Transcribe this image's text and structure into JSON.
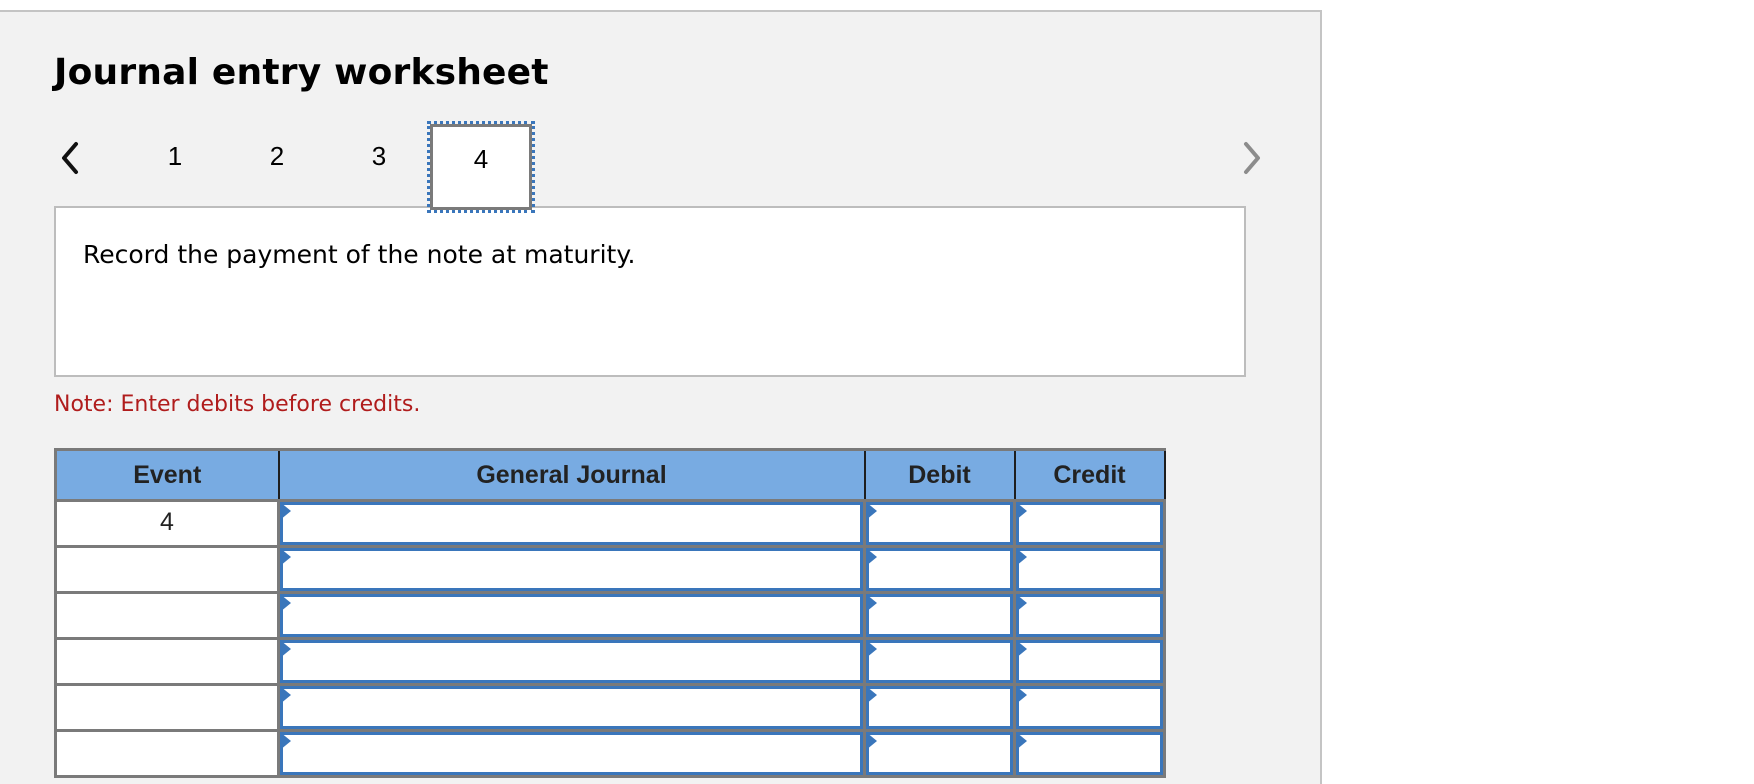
{
  "worksheet": {
    "title": "Journal entry worksheet",
    "nav": {
      "prev_icon": "chevron-left-icon",
      "next_icon": "chevron-right-icon"
    },
    "tabs": [
      {
        "label": "1",
        "active": false
      },
      {
        "label": "2",
        "active": false
      },
      {
        "label": "3",
        "active": false
      },
      {
        "label": "4",
        "active": true
      }
    ],
    "prompt": "Record the payment of the note at maturity.",
    "note": "Note: Enter debits before credits.",
    "colors": {
      "header_bg": "#78abe2",
      "input_border": "#3a76bb",
      "note_text": "#b01c1c",
      "panel_bg": "#f2f2f2"
    }
  },
  "journal": {
    "columns": [
      "Event",
      "General Journal",
      "Debit",
      "Credit"
    ],
    "rows": [
      {
        "event": "4",
        "account": "",
        "debit": "",
        "credit": ""
      },
      {
        "event": "",
        "account": "",
        "debit": "",
        "credit": ""
      },
      {
        "event": "",
        "account": "",
        "debit": "",
        "credit": ""
      },
      {
        "event": "",
        "account": "",
        "debit": "",
        "credit": ""
      },
      {
        "event": "",
        "account": "",
        "debit": "",
        "credit": ""
      },
      {
        "event": "",
        "account": "",
        "debit": "",
        "credit": ""
      }
    ]
  }
}
